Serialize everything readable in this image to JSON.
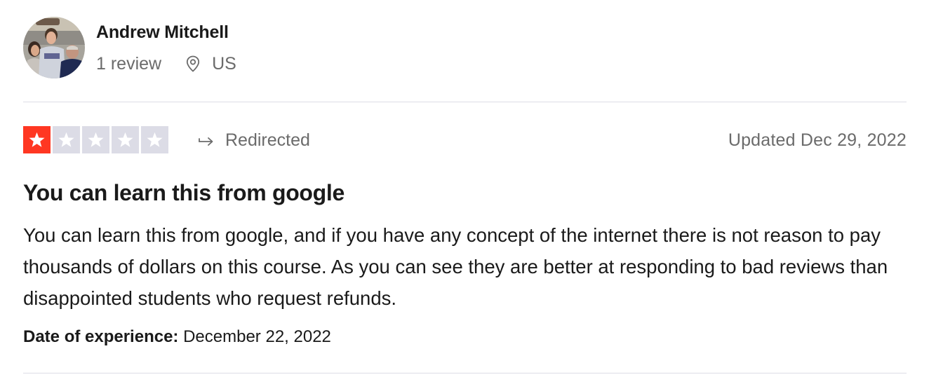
{
  "consumer": {
    "name": "Andrew Mitchell",
    "reviews": "1 review",
    "country": "US",
    "avatar_icon": "user-photo-avatar",
    "location_icon": "location-pin-icon"
  },
  "review": {
    "rating": 1,
    "rating_max": 5,
    "star_color": "#ff3722",
    "star_empty_color": "#dcdce6",
    "status_icon": "redirect-arrow-icon",
    "status_label": "Redirected",
    "updated": "Updated Dec 29, 2022",
    "title": "You can learn this from google",
    "body": "You can learn this from google, and if you have any concept of the internet there is not reason to pay thousands of dollars on this course. As you can see they are better at responding to bad reviews than disappointed students who request refunds.",
    "experience_label": "Date of experience:",
    "experience_date": "December 22, 2022"
  }
}
